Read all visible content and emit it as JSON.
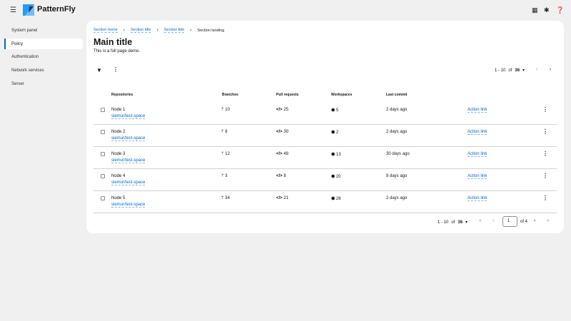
{
  "header": {
    "brand": "PatternFly",
    "icons": [
      "grid-icon",
      "gear-icon",
      "help-icon"
    ]
  },
  "sidebar": {
    "items": [
      {
        "label": "System panel"
      },
      {
        "label": "Policy",
        "active": true
      },
      {
        "label": "Authentication"
      },
      {
        "label": "Network services"
      },
      {
        "label": "Server"
      }
    ]
  },
  "breadcrumb": [
    "Section home",
    "Section title",
    "Section title",
    "Section landing"
  ],
  "main": {
    "title": "Main title",
    "description": "This is a full page demo."
  },
  "toolbar": {
    "pagination": {
      "range": "1 - 10",
      "of_label": "of",
      "total": "36"
    }
  },
  "table": {
    "headers": [
      "Repositories",
      "Branches",
      "Pull requests",
      "Workspaces",
      "Last commit"
    ],
    "rows": [
      {
        "name": "Node 1",
        "link": "siemur/test-space",
        "branches": "10",
        "prs": "25",
        "workspaces": "5",
        "last_commit": "2 days ago",
        "action": "Action link"
      },
      {
        "name": "Node 2",
        "link": "siemur/test-space",
        "branches": "8",
        "prs": "30",
        "workspaces": "2",
        "last_commit": "2 days ago",
        "action": "Action link"
      },
      {
        "name": "Node 3",
        "link": "siemur/test-space",
        "branches": "12",
        "prs": "48",
        "workspaces": "13",
        "last_commit": "30 days ago",
        "action": "Action link"
      },
      {
        "name": "Node 4",
        "link": "siemur/test-space",
        "branches": "3",
        "prs": "8",
        "workspaces": "20",
        "last_commit": "8 days ago",
        "action": "Action link"
      },
      {
        "name": "Node 5",
        "link": "siemur/test-space",
        "branches": "34",
        "prs": "21",
        "workspaces": "26",
        "last_commit": "2 days ago",
        "action": "Action link"
      }
    ]
  },
  "footer_pagination": {
    "range": "1 - 10",
    "of_label": "of",
    "total": "36",
    "page": "1",
    "of_pages": "of 4"
  }
}
